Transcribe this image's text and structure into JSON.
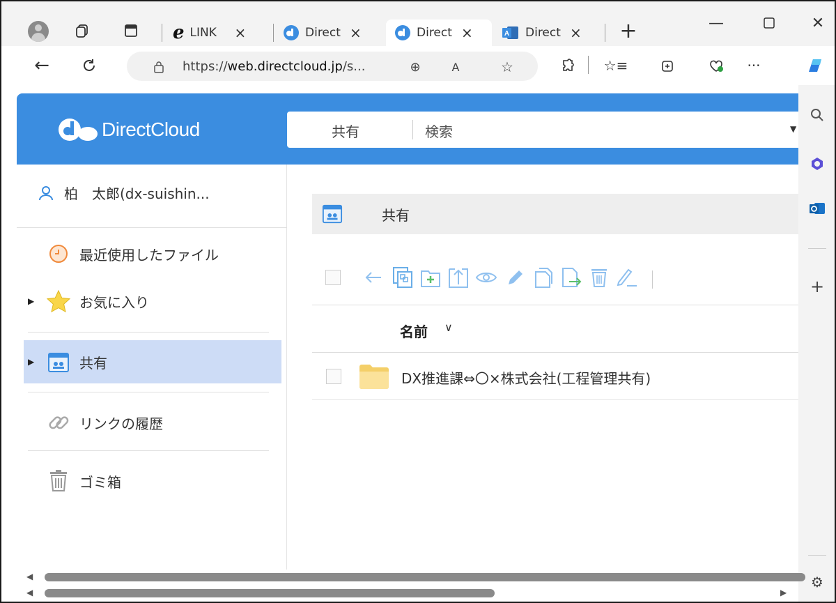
{
  "browser": {
    "tabs": [
      {
        "label": "LINK",
        "icon": "ie-e-icon",
        "active": false
      },
      {
        "label": "Direct",
        "icon": "directcloud-icon",
        "active": false
      },
      {
        "label": "Direct",
        "icon": "directcloud-icon",
        "active": true
      },
      {
        "label": "Direct",
        "icon": "access-icon",
        "active": false
      }
    ],
    "new_tab_label": "+",
    "url_scheme": "https://",
    "url_host": "web.directcloud.jp",
    "url_path": "/s...",
    "toolbar_more": "···"
  },
  "app": {
    "brand": "DirectCloud",
    "accent_color": "#3b8de0",
    "search_scope": "共有",
    "search_placeholder": "検索"
  },
  "sidebar": {
    "user_name": "柏　太郎(dx-suishin...",
    "items": [
      {
        "label": "最近使用したファイル",
        "icon": "clock-icon"
      },
      {
        "label": "お気に入り",
        "icon": "star-icon"
      },
      {
        "label": "共有",
        "icon": "shared-box-icon",
        "selected": true
      },
      {
        "label": "リンクの履歴",
        "icon": "link-icon"
      },
      {
        "label": "ゴミ箱",
        "icon": "trash-icon"
      }
    ]
  },
  "content": {
    "breadcrumb": "共有",
    "column_name": "名前",
    "rows": [
      {
        "name": "DX推進課⇔〇×株式会社(工程管理共有)",
        "icon": "folder-icon"
      }
    ]
  }
}
